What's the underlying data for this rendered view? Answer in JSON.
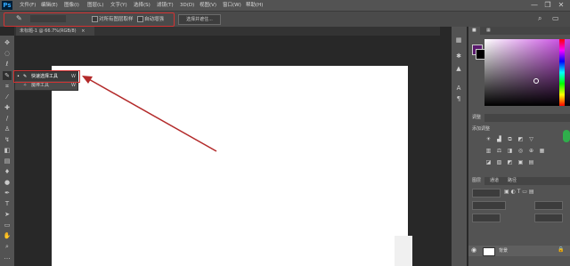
{
  "app": {
    "logo": "Ps"
  },
  "menu": [
    "文件(F)",
    "编辑(E)",
    "图像(I)",
    "图层(L)",
    "文字(Y)",
    "选择(S)",
    "滤镜(T)",
    "3D(D)",
    "视图(V)",
    "窗口(W)",
    "帮助(H)"
  ],
  "window_controls": {
    "minimize": "—",
    "restore": "❐",
    "close": "✕"
  },
  "options_bar": {
    "sample_all_layers": "对所有图层取样",
    "auto_enhance": "自动增强",
    "select_and_mask": "选择并遮住..."
  },
  "document_tab": {
    "title": "未标题-1 @ 66.7%(RGB/8)",
    "close": "×"
  },
  "tool_flyout": {
    "items": [
      {
        "label": "快速选择工具",
        "shortcut": "W"
      },
      {
        "label": "魔棒工具",
        "shortcut": "W"
      }
    ]
  },
  "panels": {
    "adjustments": {
      "tab": "调整",
      "title": "添加调整"
    },
    "layers": {
      "tabs": [
        "图层",
        "通道",
        "路径"
      ],
      "layer_name": "背景"
    }
  },
  "colors": {
    "annotation_red": "#d23232",
    "foreground": "#5a1a6e"
  },
  "icons": [
    "move-icon",
    "marquee-icon",
    "lasso-icon",
    "quick-selection-icon",
    "crop-icon",
    "eyedropper-icon",
    "healing-icon",
    "brush-icon",
    "stamp-icon",
    "history-brush-icon",
    "eraser-icon",
    "gradient-icon",
    "blur-icon",
    "dodge-icon",
    "pen-icon",
    "type-icon",
    "path-select-icon",
    "rectangle-icon",
    "hand-icon",
    "zoom-icon"
  ]
}
